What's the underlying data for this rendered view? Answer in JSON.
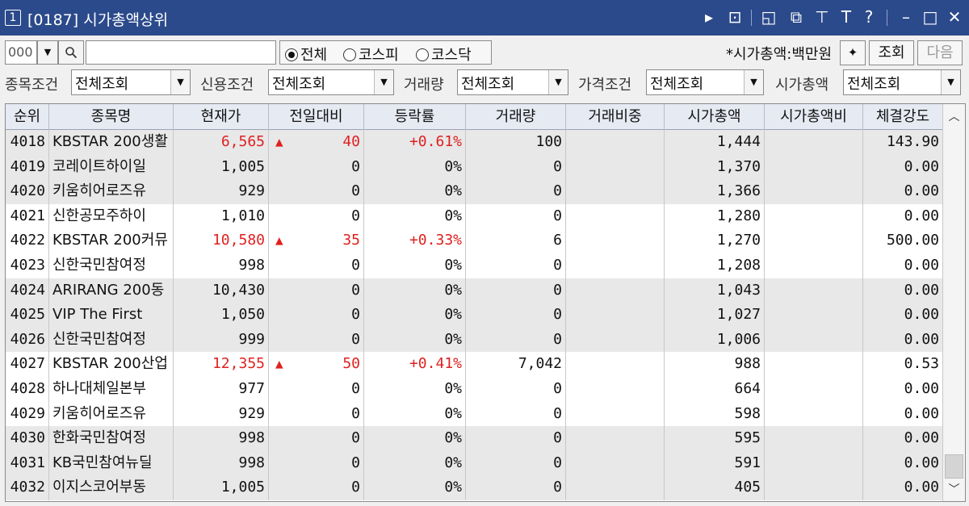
{
  "window": {
    "number": "1",
    "title": "[0187] 시가총액상위",
    "icons": [
      "play-icon",
      "memo-icon",
      "layout-icon",
      "copy-window-icon",
      "pin-icon",
      "font-icon",
      "help-icon",
      "minimize-icon",
      "maximize-icon",
      "close-icon"
    ],
    "icon_glyphs": {
      "play": "▸",
      "memo": "⊡",
      "layout": "◱",
      "copy": "⧉",
      "pin": "⊤",
      "font": "T",
      "help": "?",
      "minimize": "–",
      "maximize": "□",
      "close": "✕"
    }
  },
  "toolbar": {
    "code_value": "000",
    "name_value": "",
    "markets": [
      {
        "label": "전체",
        "selected": true
      },
      {
        "label": "코스피",
        "selected": false
      },
      {
        "label": "코스닥",
        "selected": false
      }
    ],
    "unit_label": "*시가총액:백만원",
    "query_label": "조회",
    "next_label": "다음"
  },
  "filters": [
    {
      "label": "종목조건",
      "value": "전체조회"
    },
    {
      "label": "신용조건",
      "value": "전체조회"
    },
    {
      "label": "거래량",
      "value": "전체조회"
    },
    {
      "label": "가격조건",
      "value": "전체조회"
    },
    {
      "label": "시가총액",
      "value": "전체조회"
    }
  ],
  "table": {
    "columns": [
      "순위",
      "종목명",
      "현재가",
      "전일대비",
      "등락률",
      "거래량",
      "거래비중",
      "시가총액",
      "시가총액비",
      "체결강도"
    ],
    "rows": [
      {
        "rank": "4018",
        "name": "KBSTAR 200생활",
        "price": "6,565",
        "up": true,
        "change": "40",
        "rate": "+0.61%",
        "volume": "100",
        "share": "",
        "cap": "1,444",
        "cap_ratio": "",
        "strength": "143.90"
      },
      {
        "rank": "4019",
        "name": "코레이트하이일",
        "price": "1,005",
        "up": false,
        "change": "0",
        "rate": "0%",
        "volume": "0",
        "share": "",
        "cap": "1,370",
        "cap_ratio": "",
        "strength": "0.00"
      },
      {
        "rank": "4020",
        "name": "키움히어로즈유",
        "price": "929",
        "up": false,
        "change": "0",
        "rate": "0%",
        "volume": "0",
        "share": "",
        "cap": "1,366",
        "cap_ratio": "",
        "strength": "0.00"
      },
      {
        "rank": "4021",
        "name": "신한공모주하이",
        "price": "1,010",
        "up": false,
        "change": "0",
        "rate": "0%",
        "volume": "0",
        "share": "",
        "cap": "1,280",
        "cap_ratio": "",
        "strength": "0.00"
      },
      {
        "rank": "4022",
        "name": "KBSTAR 200커뮤",
        "price": "10,580",
        "up": true,
        "change": "35",
        "rate": "+0.33%",
        "volume": "6",
        "share": "",
        "cap": "1,270",
        "cap_ratio": "",
        "strength": "500.00"
      },
      {
        "rank": "4023",
        "name": "신한국민참여정",
        "price": "998",
        "up": false,
        "change": "0",
        "rate": "0%",
        "volume": "0",
        "share": "",
        "cap": "1,208",
        "cap_ratio": "",
        "strength": "0.00"
      },
      {
        "rank": "4024",
        "name": "ARIRANG 200동",
        "price": "10,430",
        "up": false,
        "change": "0",
        "rate": "0%",
        "volume": "0",
        "share": "",
        "cap": "1,043",
        "cap_ratio": "",
        "strength": "0.00"
      },
      {
        "rank": "4025",
        "name": "VIP The First",
        "price": "1,050",
        "up": false,
        "change": "0",
        "rate": "0%",
        "volume": "0",
        "share": "",
        "cap": "1,027",
        "cap_ratio": "",
        "strength": "0.00"
      },
      {
        "rank": "4026",
        "name": "신한국민참여정",
        "price": "999",
        "up": false,
        "change": "0",
        "rate": "0%",
        "volume": "0",
        "share": "",
        "cap": "1,006",
        "cap_ratio": "",
        "strength": "0.00"
      },
      {
        "rank": "4027",
        "name": "KBSTAR 200산업",
        "price": "12,355",
        "up": true,
        "change": "50",
        "rate": "+0.41%",
        "volume": "7,042",
        "share": "",
        "cap": "988",
        "cap_ratio": "",
        "strength": "0.53"
      },
      {
        "rank": "4028",
        "name": "하나대체일본부",
        "price": "977",
        "up": false,
        "change": "0",
        "rate": "0%",
        "volume": "0",
        "share": "",
        "cap": "664",
        "cap_ratio": "",
        "strength": "0.00"
      },
      {
        "rank": "4029",
        "name": "키움히어로즈유",
        "price": "929",
        "up": false,
        "change": "0",
        "rate": "0%",
        "volume": "0",
        "share": "",
        "cap": "598",
        "cap_ratio": "",
        "strength": "0.00"
      },
      {
        "rank": "4030",
        "name": "한화국민참여정",
        "price": "998",
        "up": false,
        "change": "0",
        "rate": "0%",
        "volume": "0",
        "share": "",
        "cap": "595",
        "cap_ratio": "",
        "strength": "0.00"
      },
      {
        "rank": "4031",
        "name": "KB국민참여뉴딜",
        "price": "998",
        "up": false,
        "change": "0",
        "rate": "0%",
        "volume": "0",
        "share": "",
        "cap": "591",
        "cap_ratio": "",
        "strength": "0.00"
      },
      {
        "rank": "4032",
        "name": "이지스코어부동",
        "price": "1,005",
        "up": false,
        "change": "0",
        "rate": "0%",
        "volume": "0",
        "share": "",
        "cap": "405",
        "cap_ratio": "",
        "strength": "0.00"
      }
    ]
  },
  "colors": {
    "titlebar": "#2b4a8b",
    "up": "#e02020",
    "row_shaded": "#e8e8e8",
    "header": "#e6eaf2"
  }
}
